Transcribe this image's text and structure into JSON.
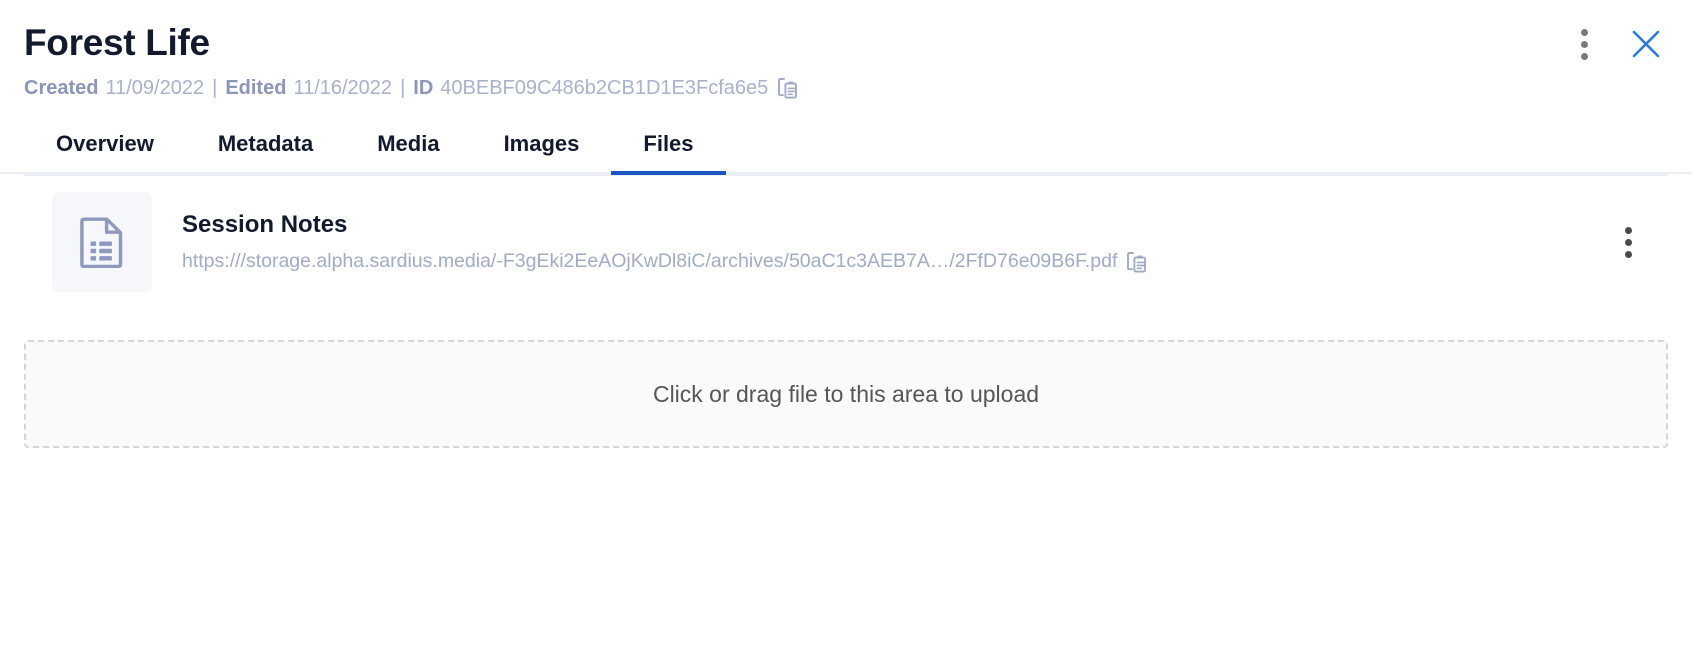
{
  "header": {
    "title": "Forest Life",
    "created_label": "Created",
    "created_value": "11/09/2022",
    "separator": "|",
    "edited_label": "Edited",
    "edited_value": "11/16/2022",
    "id_label": "ID",
    "id_value": "40BEBF09C486b2CB1D1E3Fcfa6e5",
    "copy_icon": "copy-icon",
    "more_icon": "kebab-menu-icon",
    "close_icon": "close-icon",
    "accent_color": "#1677ff",
    "title_color": "#131a2e",
    "meta_color": "#a2abc6"
  },
  "tabs": [
    {
      "label": "Overview",
      "active": false
    },
    {
      "label": "Metadata",
      "active": false
    },
    {
      "label": "Media",
      "active": false
    },
    {
      "label": "Images",
      "active": false
    },
    {
      "label": "Files",
      "active": true
    }
  ],
  "active_tab_underline_color": "#1a56c4",
  "files": [
    {
      "name": "Session Notes",
      "url": "https:///storage.alpha.sardius.media/-F3gEki2EeAOjKwDl8iC/archives/50aC1c3AEB7A…/2FfD76e09B6F.pdf",
      "thumb_icon": "document-list-icon",
      "copy_icon": "copy-icon",
      "more_icon": "kebab-menu-icon"
    }
  ],
  "dropzone": {
    "text": "Click or drag file to this area to upload"
  }
}
